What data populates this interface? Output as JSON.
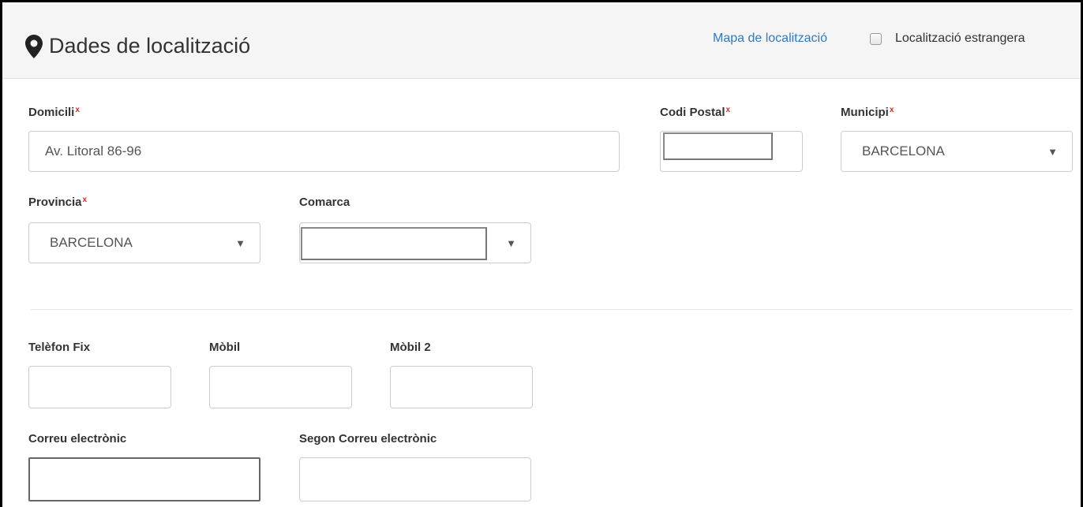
{
  "header": {
    "title": "Dades de localització",
    "map_link": "Mapa de localització",
    "foreign_label": "Localització estrangera"
  },
  "form": {
    "domicili": {
      "label": "Domicili",
      "required": "x",
      "value": "Av. Litoral 86-96"
    },
    "codi_postal": {
      "label": "Codi Postal",
      "required": "x",
      "value": ""
    },
    "municipi": {
      "label": "Municipi",
      "required": "x",
      "value": "BARCELONA"
    },
    "provincia": {
      "label": "Provincia",
      "required": "x",
      "value": "BARCELONA"
    },
    "comarca": {
      "label": "Comarca",
      "value": ""
    },
    "telefon_fix": {
      "label": "Telèfon Fix",
      "value": ""
    },
    "mobil": {
      "label": "Mòbil",
      "value": ""
    },
    "mobil2": {
      "label": "Mòbil 2",
      "value": ""
    },
    "correu": {
      "label": "Correu electrònic",
      "value": ""
    },
    "segon_correu": {
      "label": "Segon Correu electrònic",
      "value": ""
    }
  },
  "icons": {
    "caret": "▼",
    "location": "map-marker-icon"
  },
  "colors": {
    "link": "#337ab7",
    "required": "#c9302c",
    "heading_bg": "#f5f5f5"
  }
}
